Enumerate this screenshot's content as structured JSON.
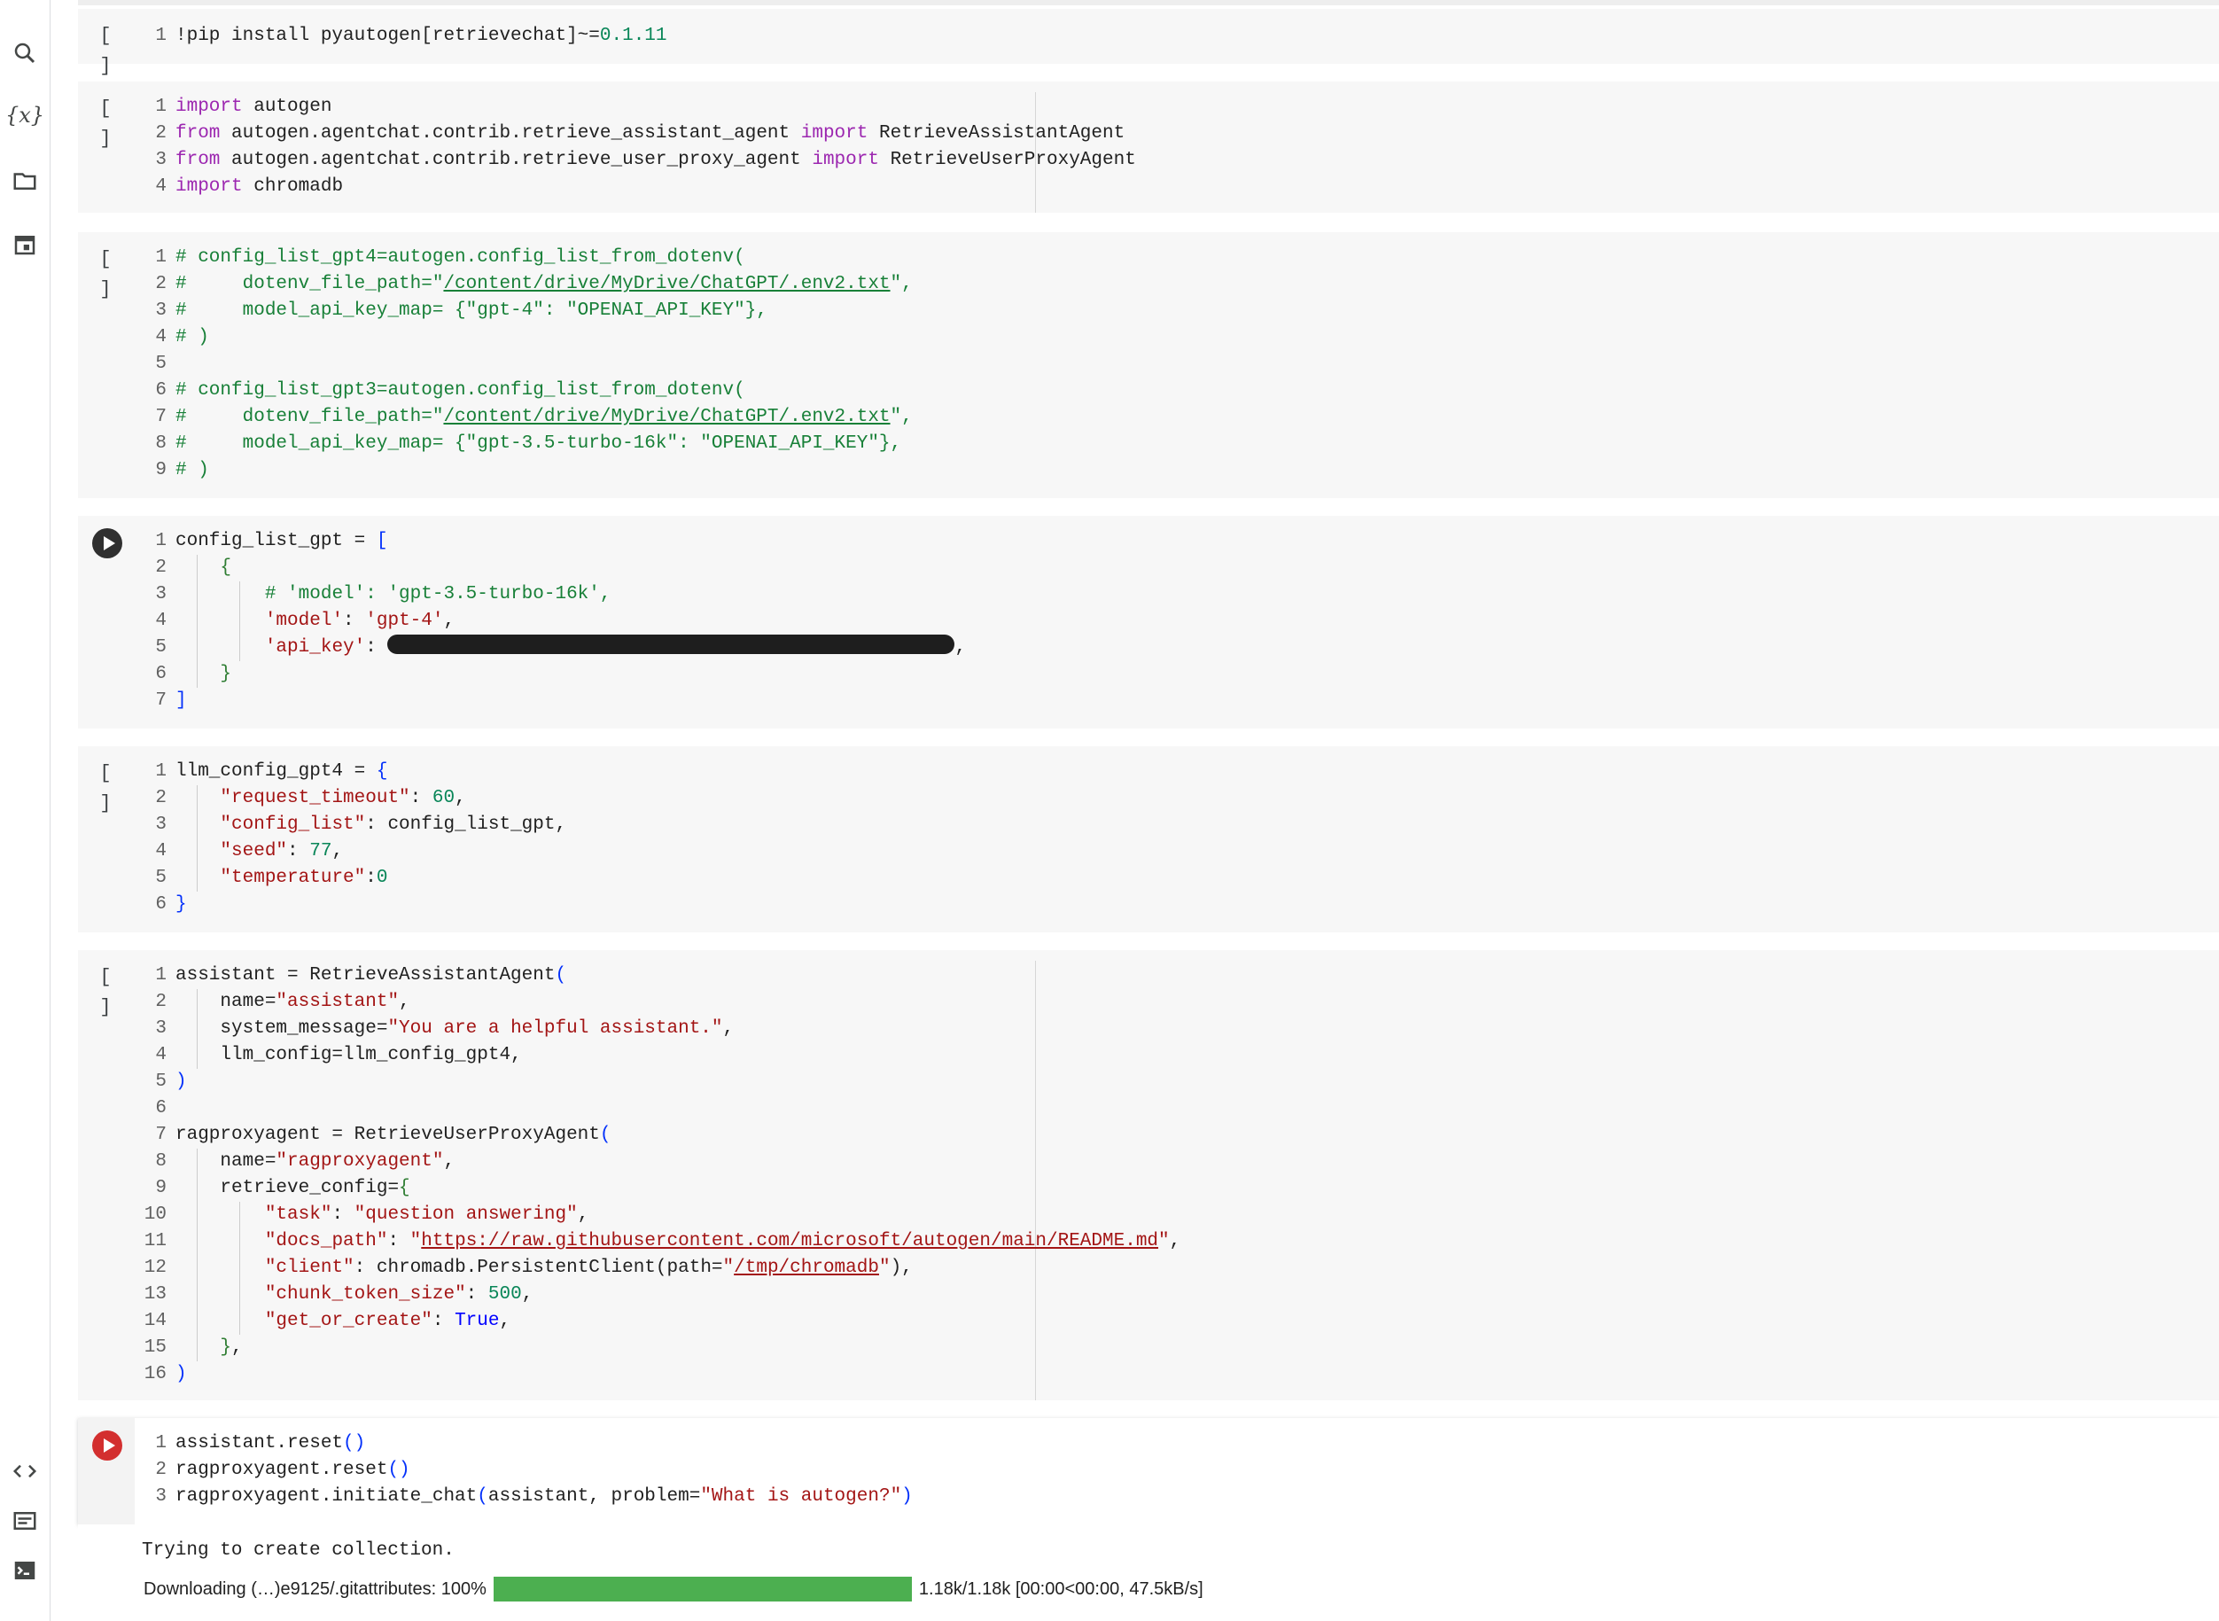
{
  "sidebar": {
    "items": [
      {
        "name": "search-icon",
        "glyph": ""
      },
      {
        "name": "variables-icon",
        "glyph": "{x}"
      },
      {
        "name": "folder-icon",
        "glyph": ""
      },
      {
        "name": "calendar-icon",
        "glyph": ""
      },
      {
        "name": "code-snippets-icon",
        "glyph": ""
      },
      {
        "name": "command-palette-icon",
        "glyph": ""
      },
      {
        "name": "terminal-icon",
        "glyph": ""
      }
    ]
  },
  "cells": [
    {
      "run_state": "[ ]",
      "lines": [
        "!pip install pyautogen[retrievechat]~=0.1.11"
      ]
    },
    {
      "run_state": "[ ]",
      "lines": [
        "import autogen",
        "from autogen.agentchat.contrib.retrieve_assistant_agent import RetrieveAssistantAgent",
        "from autogen.agentchat.contrib.retrieve_user_proxy_agent import RetrieveUserProxyAgent",
        "import chromadb"
      ]
    },
    {
      "run_state": "[ ]",
      "lines": [
        "# config_list_gpt4=autogen.config_list_from_dotenv(",
        "#     dotenv_file_path=\"/content/drive/MyDrive/ChatGPT/.env2.txt\",",
        "#     model_api_key_map= {\"gpt-4\": \"OPENAI_API_KEY\"},",
        "# )",
        "",
        "# config_list_gpt3=autogen.config_list_from_dotenv(",
        "#     dotenv_file_path=\"/content/drive/MyDrive/ChatGPT/.env2.txt\",",
        "#     model_api_key_map= {\"gpt-3.5-turbo-16k\": \"OPENAI_API_KEY\"},",
        "# )"
      ]
    },
    {
      "run_state": "play",
      "lines": [
        "config_list_gpt = [",
        "    {",
        "        # 'model': 'gpt-3.5-turbo-16k',",
        "        'model': 'gpt-4',",
        "        'api_key': ",
        "    }",
        "]"
      ]
    },
    {
      "run_state": "[ ]",
      "lines": [
        "llm_config_gpt4 = {",
        "    \"request_timeout\": 60,",
        "    \"config_list\": config_list_gpt,",
        "    \"seed\": 77,",
        "    \"temperature\":0",
        "}"
      ]
    },
    {
      "run_state": "[ ]",
      "lines": [
        "assistant = RetrieveAssistantAgent(",
        "    name=\"assistant\",",
        "    system_message=\"You are a helpful assistant.\",",
        "    llm_config=llm_config_gpt4,",
        ")",
        "",
        "ragproxyagent = RetrieveUserProxyAgent(",
        "    name=\"ragproxyagent\",",
        "    retrieve_config={",
        "        \"task\": \"question answering\",",
        "        \"docs_path\": \"https://raw.githubusercontent.com/microsoft/autogen/main/README.md\",",
        "        \"client\": chromadb.PersistentClient(path=\"/tmp/chromadb\"),",
        "        \"chunk_token_size\": 500,",
        "        \"get_or_create\": True,",
        "    },",
        ")"
      ]
    },
    {
      "run_state": "running",
      "lines": [
        "assistant.reset()",
        "ragproxyagent.reset()",
        "ragproxyagent.initiate_chat(assistant, problem=\"What is autogen?\")"
      ]
    }
  ],
  "output": {
    "text": "Trying to create collection.",
    "progress_label": "Downloading (…)e9125/.gitattributes: 100%",
    "progress_fraction": 1.0,
    "progress_stats": "1.18k/1.18k [00:00<00:00, 47.5kB/s]",
    "progress_color": "#4caf50"
  },
  "colors": {
    "cell_bg": "#f7f7f7",
    "keyword": "#9c27b0",
    "comment": "#188038",
    "string": "#a31515",
    "number": "#098658",
    "run_red": "#d32f2f"
  }
}
